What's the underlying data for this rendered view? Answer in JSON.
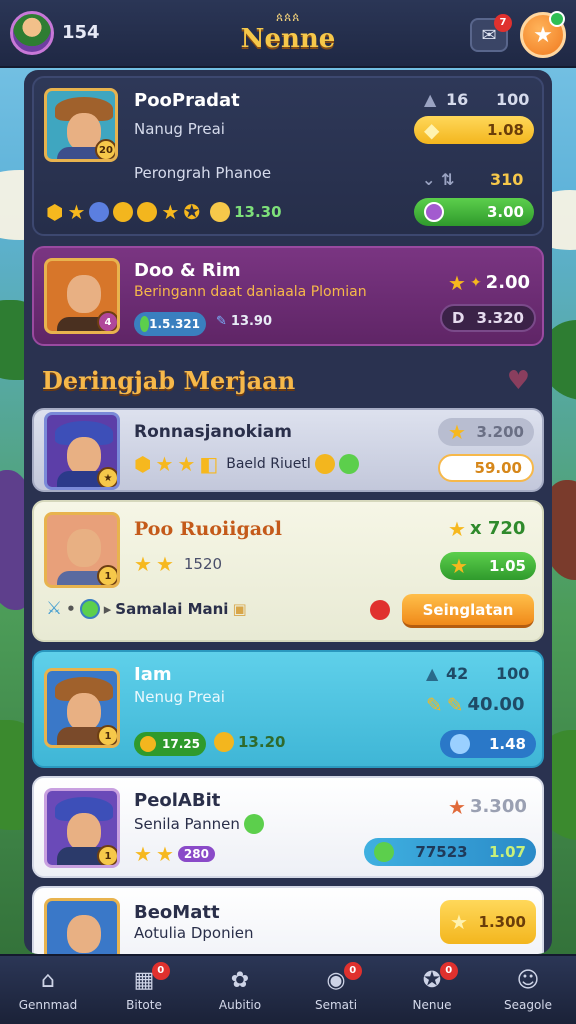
{
  "header": {
    "coins": "154",
    "crown_text": "ጰጰጰ",
    "title": "Nenne",
    "mail_badge": "7",
    "mail_icon": "mail-icon",
    "star_icon": "star-icon"
  },
  "cards": [
    {
      "name": "PooPradat",
      "subtitle": "Nanug Preai",
      "line3": "Perongrah Phanoe",
      "level": "20",
      "stat_top_a": "16",
      "stat_top_b": "100",
      "pill1_value": "1.08",
      "stat_mid": "310",
      "pill2_value": "3.00",
      "icons_value": "13.30",
      "accent": "#f6c84a"
    },
    {
      "name": "Doo & Rim",
      "subtitle": "Beringann daat daniaala Plomian",
      "chip1": "1.5.321",
      "chip2": "13.90",
      "level": "4",
      "stat_a": "2.00",
      "stat_b": "3.320",
      "stat_b_prefix": "D"
    },
    {
      "name": "Ronnasjanokiam",
      "icons_text": "Baeld Riuetl",
      "level": "",
      "stat_a": "3.200",
      "stat_b": "59.00"
    },
    {
      "name": "Poo Ruoiigaol",
      "value_small": "1520",
      "stat_a": "x 720",
      "pill_value": "1.05",
      "row_text": "Samalai Mani",
      "button_label": "Seinglatan",
      "level": "1"
    },
    {
      "name": "Iam",
      "subtitle": "Nenug Preai",
      "stat_top_a": "42",
      "stat_top_b": "100",
      "stat_mid": "40.00",
      "chip1": "17.25",
      "chip2": "13.20",
      "pill_value": "1.48",
      "level": "1"
    },
    {
      "name": "PeolABit",
      "subtitle": "Senila Pannen",
      "chip": "280",
      "stat_a": "3.300",
      "bar_value": "77523",
      "bar_right": "1.07",
      "level": "1"
    },
    {
      "name": "BeoMatt",
      "subtitle": "Aotulia Dponien",
      "stat_a": "1.300"
    }
  ],
  "section": {
    "title": "Deringjab Merjaan"
  },
  "nav": [
    {
      "label": "Gennmad",
      "icon": "home-icon",
      "badge": ""
    },
    {
      "label": "Bitote",
      "icon": "cards-icon",
      "badge": "0"
    },
    {
      "label": "Aubitio",
      "icon": "paw-icon",
      "badge": ""
    },
    {
      "label": "Semati",
      "icon": "chat-icon",
      "badge": "0"
    },
    {
      "label": "Nenue",
      "icon": "badge-icon",
      "badge": "0"
    },
    {
      "label": "Seagole",
      "icon": "profile-icon",
      "badge": ""
    }
  ],
  "colors": {
    "topbar": "#1f2844",
    "title_gold": "#f6c84a",
    "panel": "#2a3250",
    "card_purple": "#6b2d6a",
    "card_cream": "#f1f2e2",
    "card_cyan": "#4cc3e0",
    "pill_yellow": "#f6c84a",
    "pill_green": "#3ca63c",
    "badge_red": "#e0312e"
  }
}
